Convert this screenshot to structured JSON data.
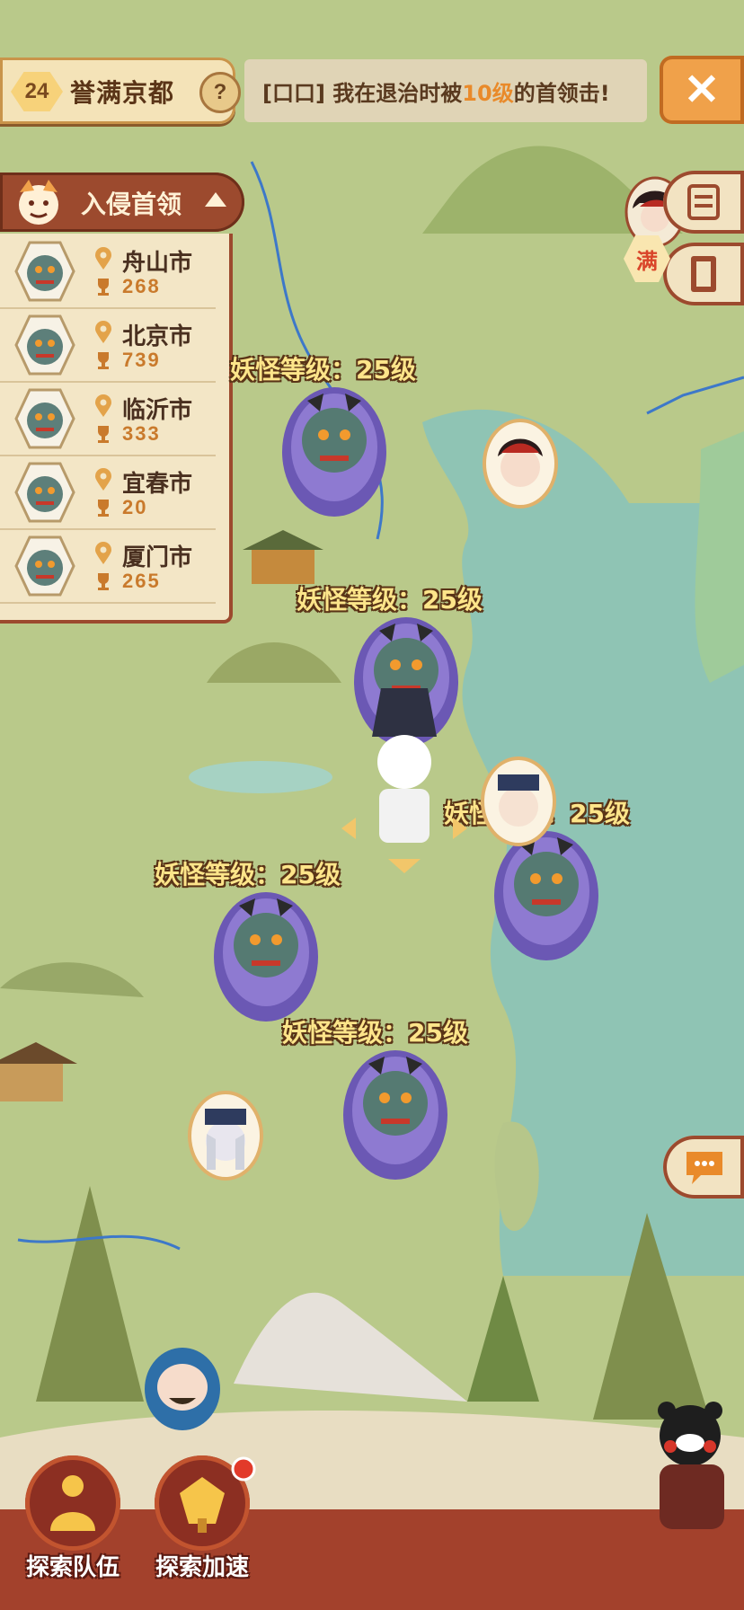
{
  "header": {
    "level": "24",
    "region_title": "誉满京都",
    "help_label": "?",
    "notice_prefix": "[口口] 我在退治时被",
    "notice_highlight": "10级",
    "notice_suffix": "的首领击!",
    "close_label": "✕"
  },
  "boss_panel": {
    "title": "入侵首领",
    "items": [
      {
        "city": "舟山市",
        "count": "268"
      },
      {
        "city": "北京市",
        "count": "739"
      },
      {
        "city": "临沂市",
        "count": "333"
      },
      {
        "city": "宜春市",
        "count": "20"
      },
      {
        "city": "厦门市",
        "count": "265"
      }
    ]
  },
  "side": {
    "full_badge": "满"
  },
  "map_labels": [
    "妖怪等级：25级",
    "妖怪等级：25级",
    "妖怪等级：25级",
    "妖怪等级：25级",
    "妖怪等级：25级"
  ],
  "bottom": {
    "team_label": "探索队伍",
    "speed_label": "探索加速"
  },
  "colors": {
    "panel_brown": "#9c4a2e",
    "sea": "#8fc4b4",
    "land": "#b9c98a",
    "accent_orange": "#e98a2a"
  },
  "icons": {
    "close": "close-icon",
    "help": "question-icon",
    "menu": "list-icon",
    "card": "card-icon",
    "chat": "chat-icon",
    "pin": "location-pin-icon",
    "trophy": "trophy-icon"
  }
}
